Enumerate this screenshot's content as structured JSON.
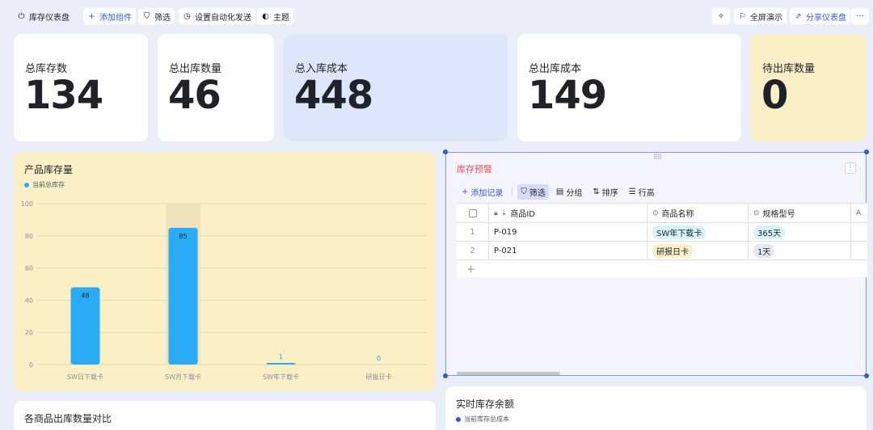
{
  "toolbar": {
    "dashboard_name": "库存仪表盘",
    "add_component": "添加组件",
    "filter": "筛选",
    "auto_send": "设置自动化发送",
    "theme": "主题",
    "fullscreen": "全屏演示",
    "share": "分享仪表盘",
    "more": "···"
  },
  "stats": [
    {
      "label": "总库存数",
      "value": "134"
    },
    {
      "label": "总出库数量",
      "value": "46"
    },
    {
      "label": "总入库成本",
      "value": "448"
    },
    {
      "label": "总出库成本",
      "value": "149"
    },
    {
      "label": "待出库数量",
      "value": "0"
    }
  ],
  "chart_data": {
    "type": "bar",
    "title": "产品库存量",
    "series": [
      {
        "name": "当前总库存",
        "values": [
          48,
          85,
          1,
          0
        ]
      }
    ],
    "categories": [
      "SW日下载卡",
      "SW月下载卡",
      "SW年下载卡",
      "研报日卡"
    ],
    "ylim": [
      0,
      100
    ],
    "yticks": [
      "0",
      "20",
      "40",
      "60",
      "80",
      "100"
    ],
    "grid": true,
    "legend": "top-left",
    "highlight_category": 1,
    "colors": {
      "bar": "#2aabf5",
      "background": "#fbefc6",
      "highlight": "#efe3bc"
    }
  },
  "warning": {
    "title": "库存预警",
    "tools": {
      "add": "添加记录",
      "filter": "筛选",
      "group": "分组",
      "sort": "排序",
      "row_height": "行高"
    },
    "columns": [
      "商品ID",
      "商品名称",
      "规格型号"
    ],
    "rows": [
      {
        "idx": "1",
        "id": "P-019",
        "name": "SW年下载卡",
        "spec": "365天"
      },
      {
        "idx": "2",
        "id": "P-021",
        "name": "研报日卡",
        "spec": "1天"
      }
    ],
    "add_row": "+"
  },
  "bottom": {
    "left_title": "各商品出库数量对比",
    "right_title": "实时库存余额",
    "right_legend": "当前库存总成本"
  }
}
